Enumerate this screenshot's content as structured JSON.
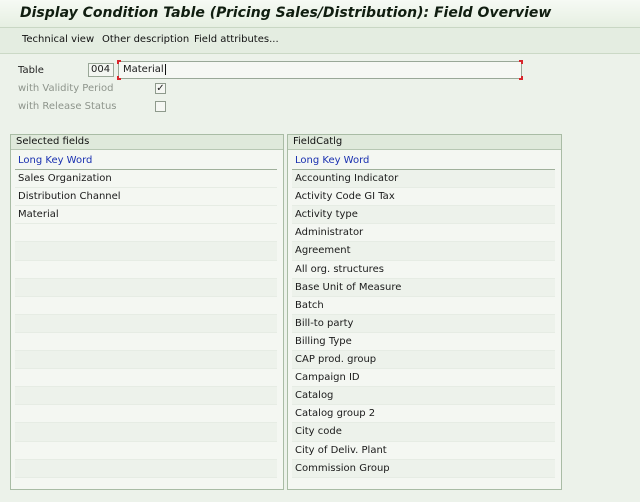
{
  "window": {
    "title": "Display Condition Table (Pricing Sales/Distribution): Field Overview"
  },
  "toolbar": {
    "items": [
      "Technical view",
      "Other description",
      "Field attributes..."
    ]
  },
  "header_fields": {
    "table_label": "Table",
    "table_code": "004",
    "table_description": "Material",
    "validity_label": "with Validity Period",
    "validity_checked": true,
    "release_label": "with Release Status",
    "release_checked": false
  },
  "selected_fields": {
    "title": "Selected fields",
    "column_header": "Long Key Word",
    "rows": [
      "Sales Organization",
      "Distribution Channel",
      "Material"
    ]
  },
  "field_catalog": {
    "title": "FieldCatlg",
    "column_header": "Long Key Word",
    "rows": [
      "Accounting Indicator",
      "Activity Code GI Tax",
      "Activity type",
      "Administrator",
      "Agreement",
      "All org. structures",
      "Base Unit of Measure",
      "Batch",
      "Bill-to party",
      "Billing Type",
      "CAP prod. group",
      "Campaign ID",
      "Catalog",
      "Catalog group 2",
      "City code",
      "City of Deliv. Plant",
      "Commission Group"
    ]
  },
  "colors": {
    "background": "#ecf2ea",
    "header_text": "#1a30b0",
    "focus_corner": "#d8262c"
  }
}
